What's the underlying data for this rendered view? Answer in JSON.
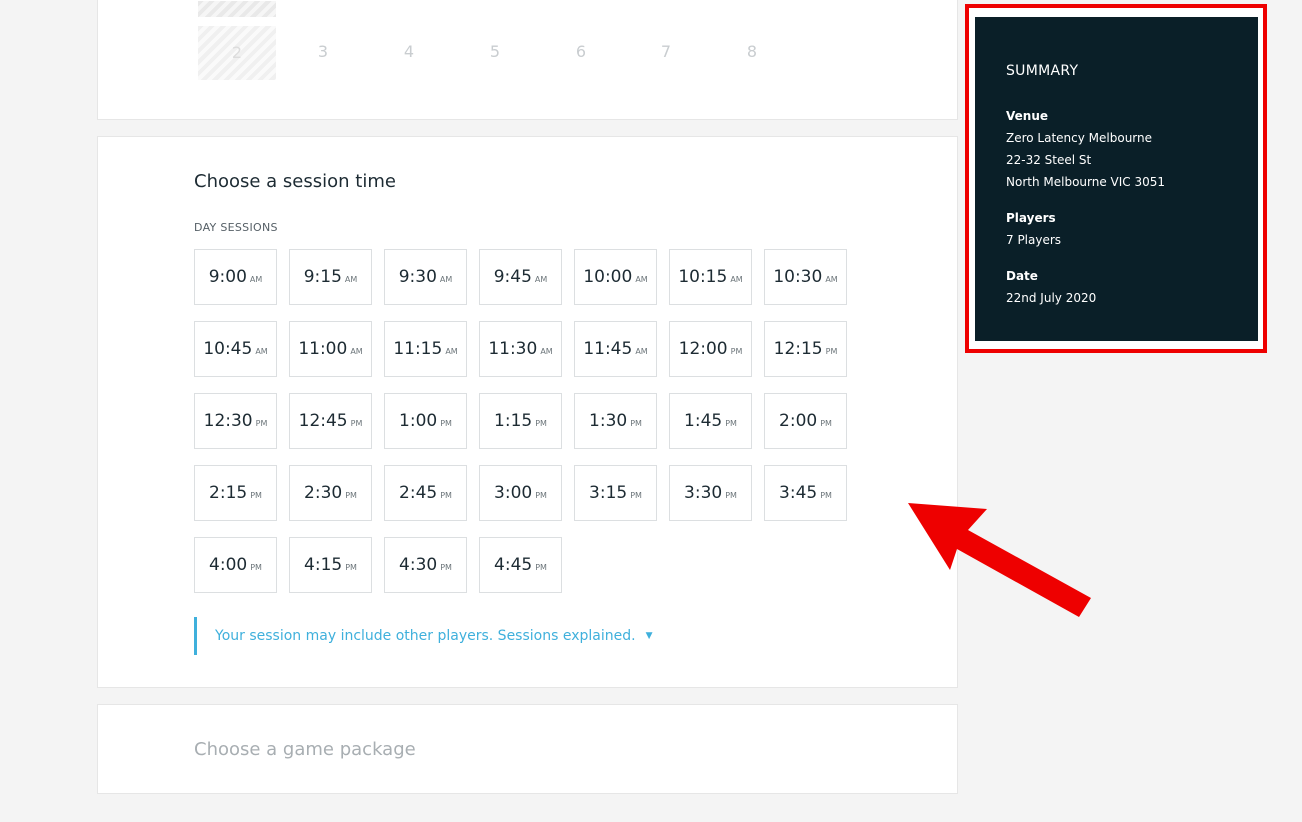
{
  "players_picker": {
    "selected": "2",
    "numbers": [
      "3",
      "4",
      "5",
      "6",
      "7",
      "8"
    ]
  },
  "session": {
    "title": "Choose a session time",
    "day_label": "DAY SESSIONS",
    "slots": [
      {
        "time": "9:00",
        "period": "AM"
      },
      {
        "time": "9:15",
        "period": "AM"
      },
      {
        "time": "9:30",
        "period": "AM"
      },
      {
        "time": "9:45",
        "period": "AM"
      },
      {
        "time": "10:00",
        "period": "AM"
      },
      {
        "time": "10:15",
        "period": "AM"
      },
      {
        "time": "10:30",
        "period": "AM"
      },
      {
        "time": "10:45",
        "period": "AM"
      },
      {
        "time": "11:00",
        "period": "AM"
      },
      {
        "time": "11:15",
        "period": "AM"
      },
      {
        "time": "11:30",
        "period": "AM"
      },
      {
        "time": "11:45",
        "period": "AM"
      },
      {
        "time": "12:00",
        "period": "PM"
      },
      {
        "time": "12:15",
        "period": "PM"
      },
      {
        "time": "12:30",
        "period": "PM"
      },
      {
        "time": "12:45",
        "period": "PM"
      },
      {
        "time": "1:00",
        "period": "PM"
      },
      {
        "time": "1:15",
        "period": "PM"
      },
      {
        "time": "1:30",
        "period": "PM"
      },
      {
        "time": "1:45",
        "period": "PM"
      },
      {
        "time": "2:00",
        "period": "PM"
      },
      {
        "time": "2:15",
        "period": "PM"
      },
      {
        "time": "2:30",
        "period": "PM"
      },
      {
        "time": "2:45",
        "period": "PM"
      },
      {
        "time": "3:00",
        "period": "PM"
      },
      {
        "time": "3:15",
        "period": "PM"
      },
      {
        "time": "3:30",
        "period": "PM"
      },
      {
        "time": "3:45",
        "period": "PM"
      },
      {
        "time": "4:00",
        "period": "PM"
      },
      {
        "time": "4:15",
        "period": "PM"
      },
      {
        "time": "4:30",
        "period": "PM"
      },
      {
        "time": "4:45",
        "period": "PM"
      }
    ],
    "note": "Your session may include other players. Sessions explained.",
    "note_icon": "caret-down-icon"
  },
  "package": {
    "title": "Choose a game package"
  },
  "summary": {
    "title": "SUMMARY",
    "venue_label": "Venue",
    "venue_name": "Zero Latency Melbourne",
    "venue_street": "22-32 Steel St",
    "venue_city": "North Melbourne VIC 3051",
    "players_label": "Players",
    "players_value": "7 Players",
    "date_label": "Date",
    "date_value": "22nd July 2020"
  },
  "colors": {
    "accent": "#3fb0dc",
    "summary_bg": "#0a1f28",
    "annotation_red": "#ee0000"
  }
}
